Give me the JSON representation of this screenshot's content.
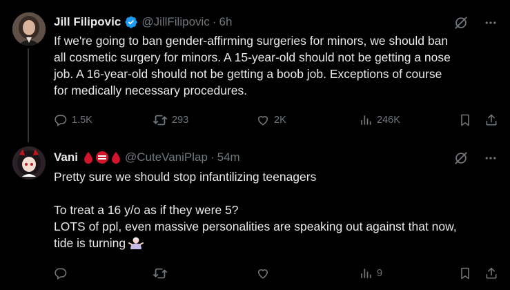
{
  "tweets": [
    {
      "name": "Jill Filipovic",
      "handle": "@JillFilipovic",
      "separator": "·",
      "time": "6h",
      "text_lines": [
        "If we're going to ban gender-affirming surgeries for minors, we should ban",
        "all cosmetic surgery for minors. A 15-year-old should not be getting a nose",
        "job. A 16-year-old should not be getting a boob job. Exceptions of course",
        "for medically necessary procedures."
      ],
      "replies": "1.5K",
      "reposts": "293",
      "likes": "2K",
      "views": "246K"
    },
    {
      "name": "Vani",
      "handle": "@CuteVaniPlap",
      "separator": "·",
      "time": "54m",
      "text_line1": "Pretty sure we should stop infantilizing teenagers",
      "text_line2": "To treat a 16 y/o as if they were 5?",
      "text_line3": "LOTS of ppl, even massive personalities are speaking out against that now,",
      "text_line4": "tide is turning",
      "views": "9"
    }
  ],
  "icons": {
    "verified": "verified-badge-icon",
    "grok": "grok-icon",
    "more": "more-icon",
    "reply": "reply-icon",
    "repost": "repost-icon",
    "like": "like-icon",
    "views": "views-icon",
    "bookmark": "bookmark-icon",
    "share": "share-icon"
  },
  "colors": {
    "background": "#000000",
    "text": "#e7e9ea",
    "muted": "#71767b",
    "verified": "#1d9bf0",
    "thread_line": "#333639",
    "blood_drop": "#d0142c"
  }
}
